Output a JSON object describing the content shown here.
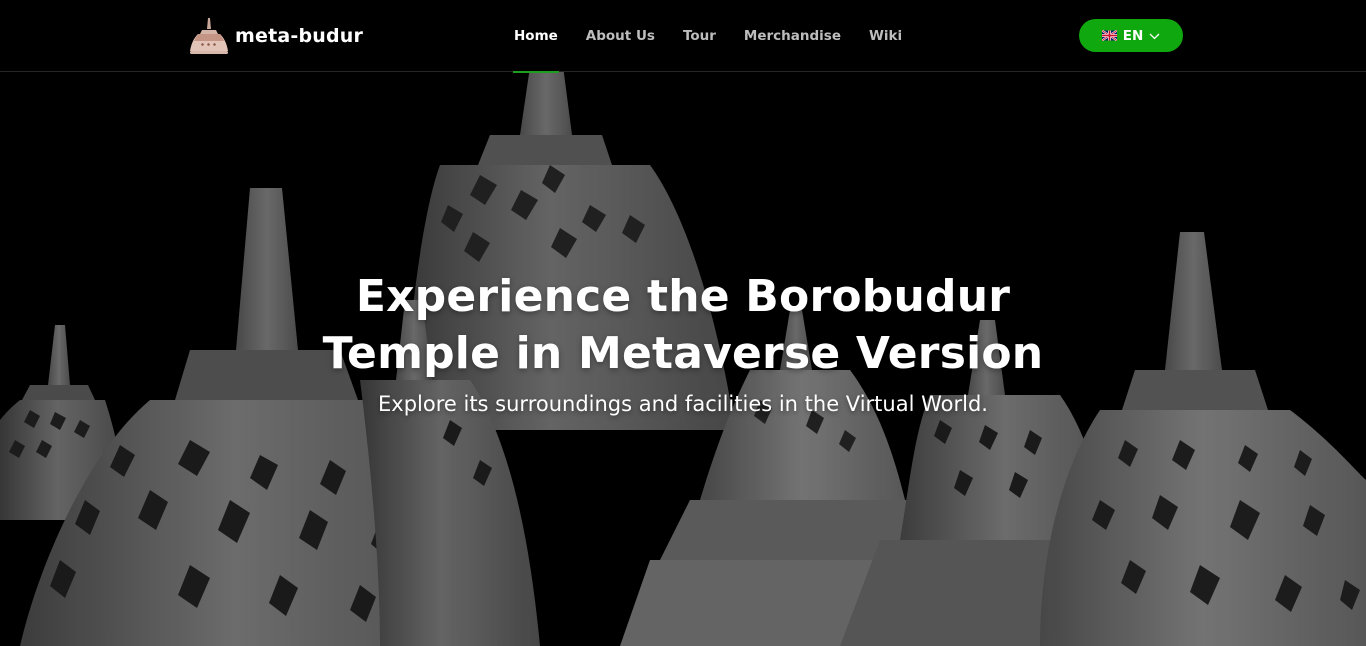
{
  "brand": {
    "name": "meta-budur",
    "logo_icon": "stupa-logo-icon"
  },
  "nav": {
    "items": [
      {
        "label": "Home",
        "active": true
      },
      {
        "label": "About Us",
        "active": false
      },
      {
        "label": "Tour",
        "active": false
      },
      {
        "label": "Merchandise",
        "active": false
      },
      {
        "label": "Wiki",
        "active": false
      }
    ]
  },
  "language": {
    "label": "EN",
    "flag_icon": "uk-flag-icon",
    "dropdown_icon": "chevron-down-icon"
  },
  "hero": {
    "title_line1": "Experience the Borobudur",
    "title_line2": "Temple in Metaverse Version",
    "subtitle": "Explore its surroundings and facilities in the Virtual World.",
    "background": "borobudur-stupas-image"
  },
  "colors": {
    "accent": "#0fa80f",
    "nav_active_underline": "#1e9e1e",
    "header_background": "#000000",
    "nav_text": "#bdbdbd",
    "text": "#ffffff"
  }
}
